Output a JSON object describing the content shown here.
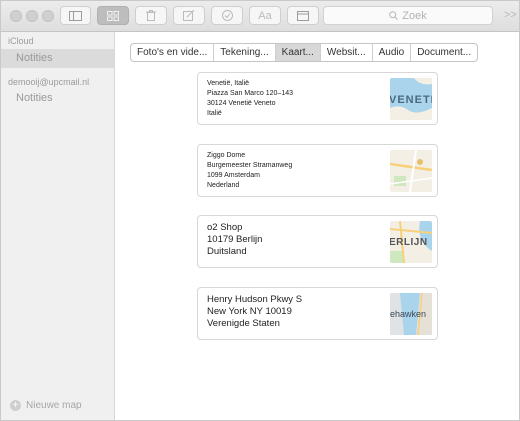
{
  "toolbar": {
    "search_placeholder": "Zoek",
    "buttons": [
      "sidebar-toggle",
      "attachments-view",
      "delete",
      "compose",
      "checklist",
      "format",
      "gallery"
    ]
  },
  "sidebar": {
    "accounts": [
      {
        "label": "iCloud",
        "folders": [
          {
            "label": "Notities",
            "selected": true
          }
        ]
      },
      {
        "label": "demooij@upcmail.nl",
        "folders": [
          {
            "label": "Notities",
            "selected": false
          }
        ]
      }
    ],
    "new_folder_label": "Nieuwe map"
  },
  "tabs": [
    {
      "label": "Foto's en vide...",
      "selected": false
    },
    {
      "label": "Tekening...",
      "selected": false
    },
    {
      "label": "Kaart...",
      "selected": true
    },
    {
      "label": "Websit...",
      "selected": false
    },
    {
      "label": "Audio",
      "selected": false
    },
    {
      "label": "Document...",
      "selected": false
    }
  ],
  "locations": [
    {
      "lines": [
        "Venetië, Italië",
        "Piazza San Marco 120–143",
        "30124 Venetië Veneto",
        "Italië"
      ],
      "map_label": "VENETI",
      "size": "small"
    },
    {
      "lines": [
        "Ziggo Dome",
        "Burgemeester Stramanweg",
        "1099 Amsterdam",
        "Nederland"
      ],
      "map_label": "",
      "size": "small"
    },
    {
      "lines": [
        "o2 Shop",
        "10179 Berlijn",
        "Duitsland"
      ],
      "map_label": "ERLIJN",
      "size": "large"
    },
    {
      "lines": [
        "Henry Hudson Pkwy S",
        "New York NY 10019",
        "Verenigde Staten"
      ],
      "map_label": "ehawken",
      "size": "large"
    }
  ],
  "colors": {
    "water": "#a9d4ec",
    "land": "#f3efe5",
    "park": "#cfe8bf",
    "road": "#f7d07a"
  }
}
